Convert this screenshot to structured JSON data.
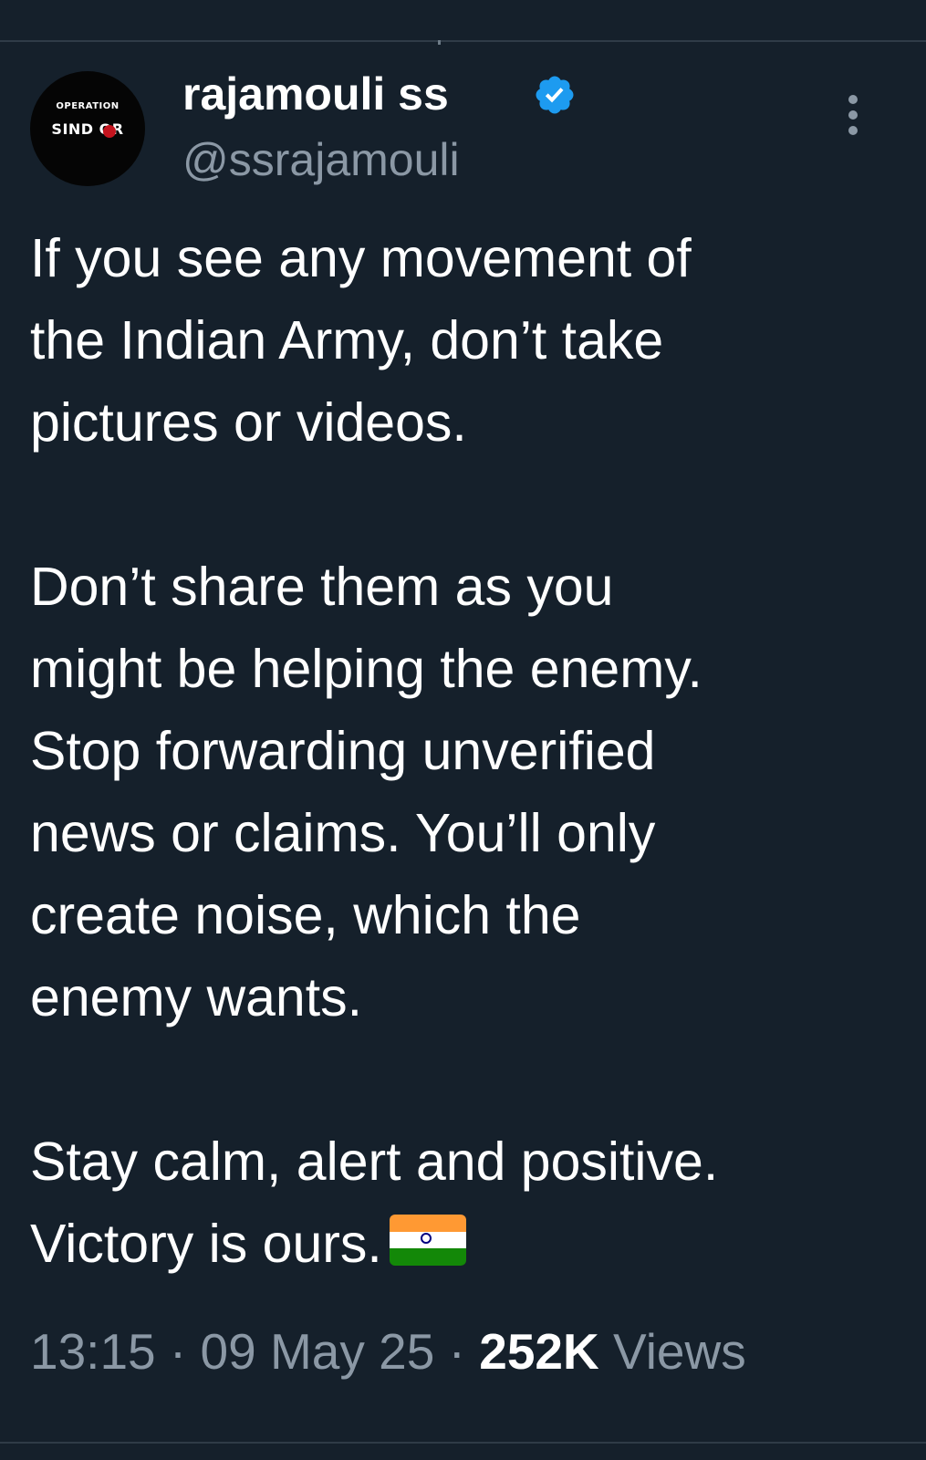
{
  "author": {
    "display_name": "rajamouli ss",
    "handle": "@ssrajamouli",
    "avatar_text_top": "OPERATION",
    "avatar_text_bottom": "SIND  OR"
  },
  "tweet": {
    "paragraph_1": "If you see any movement of\nthe Indian Army, don’t take\npictures or videos.",
    "paragraph_2": "Don’t share them as you\nmight be helping the enemy.\nStop forwarding unverified\nnews or claims. You’ll only\ncreate noise, which the\nenemy wants.",
    "paragraph_3": "Stay calm, alert and positive.\nVictory is ours."
  },
  "meta": {
    "time": "13:15",
    "separator": "·",
    "date": "09 May 25",
    "views_count": "252K",
    "views_label": "Views"
  },
  "colors": {
    "background": "#15202b",
    "text_primary": "#ffffff",
    "text_secondary": "#8b98a5",
    "verified_badge": "#1d9bf0",
    "avatar_accent": "#c4141e"
  },
  "icons": {
    "verified": "verified-badge-icon",
    "more": "more-options-icon",
    "flag": "india-flag-emoji"
  }
}
